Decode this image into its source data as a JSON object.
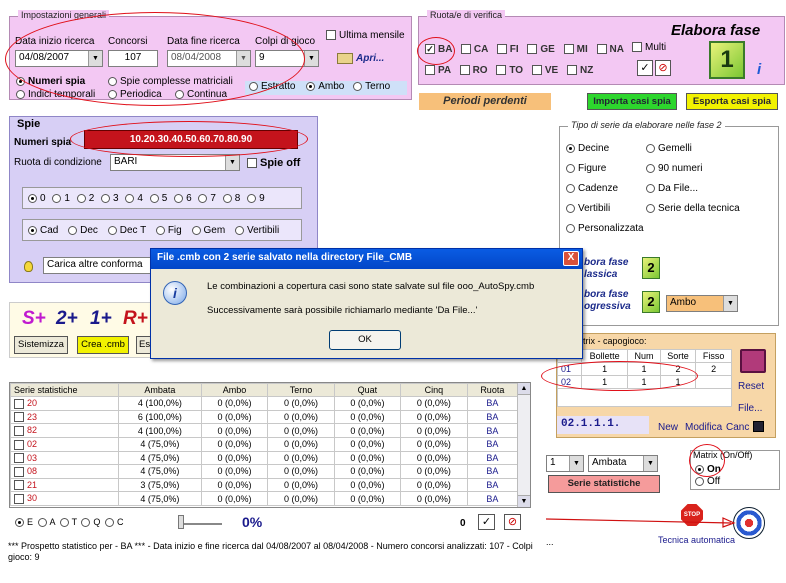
{
  "general": {
    "legend": "Impostazioni generali",
    "date_start_label": "Data inizio ricerca",
    "date_start": "04/08/2007",
    "concorsi_label": "Concorsi",
    "concorsi": "107",
    "date_end_label": "Data fine ricerca",
    "date_end": "08/04/2008",
    "colpi_label": "Colpi di gioco",
    "colpi": "9",
    "ultima_mensile": "Ultima mensile",
    "apri": "Apri...",
    "modes": [
      "Numeri spia",
      "Spie complesse matriciali",
      "Indici temporali",
      "Periodica",
      "Continua"
    ],
    "play_modes": [
      "Estratto",
      "Ambo",
      "Terno"
    ]
  },
  "ruote": {
    "legend": "Ruota/e di verifica",
    "row1": [
      "BA",
      "CA",
      "FI",
      "GE",
      "MI",
      "NA"
    ],
    "row2": [
      "PA",
      "RO",
      "TO",
      "VE",
      "NZ"
    ],
    "multi": "Multi"
  },
  "elabora": {
    "title": "Elabora fase",
    "number": "1"
  },
  "periodi_perdenti": "Periodi perdenti",
  "importa": "Importa casi spia",
  "esporta": "Esporta casi spia",
  "spie": {
    "legend": "Spie",
    "numeri_label": "Numeri spia",
    "numeri_value": "10.20.30.40.50.60.70.80.90",
    "ruota_label": "Ruota di condizione",
    "ruota_value": "BARI",
    "spie_off": "Spie off",
    "digits": [
      "0",
      "1",
      "2",
      "3",
      "4",
      "5",
      "6",
      "7",
      "8",
      "9"
    ],
    "groups": [
      "Cad",
      "Dec",
      "Dec T",
      "Fig",
      "Gem",
      "Vertibili"
    ],
    "carica": "Carica altre conforma"
  },
  "tipo_serie": {
    "legend": "Tipo di serie da elaborare nelle fase 2",
    "left": [
      "Decine",
      "Figure",
      "Cadenze",
      "Vertibili",
      "Personalizzata"
    ],
    "right": [
      "Gemelli",
      "90 numeri",
      "Da File...",
      "Serie della tecnica"
    ],
    "fase_classica": "bora fase\nlassica",
    "fase_progressiva": "bora fase\nogressiva",
    "ambo": "Ambo",
    "fase_num": "2"
  },
  "toolbar_left": {
    "s_plus": "S+",
    "two_plus": "2+",
    "one_plus": "1+",
    "r_plus": "R+",
    "sistemizza": "Sistemizza",
    "crea_cmb": "Crea .cmb",
    "es": "Es"
  },
  "matrix": {
    "legend": "ri Matrix - capogioco:",
    "headers": [
      "",
      "Bollette",
      "Num",
      "Sorte",
      "Fisso"
    ],
    "rows": [
      [
        "01",
        "1",
        "1",
        "2",
        "2"
      ],
      [
        "02",
        "1",
        "1",
        "1",
        ""
      ]
    ],
    "code": "02.1.1.1.",
    "new": "New",
    "modifica": "Modifica",
    "canc": "Canc",
    "reset": "Reset",
    "file": "File..."
  },
  "stats": {
    "headers": [
      "Serie statistiche",
      "Ambata",
      "Ambo",
      "Terno",
      "Quat",
      "Cinq",
      "Ruota"
    ],
    "rows": [
      [
        "20",
        "4 (100,0%)",
        "0 (0,0%)",
        "0 (0,0%)",
        "0 (0,0%)",
        "0 (0,0%)",
        "BA"
      ],
      [
        "23",
        "6 (100,0%)",
        "0 (0,0%)",
        "0 (0,0%)",
        "0 (0,0%)",
        "0 (0,0%)",
        "BA"
      ],
      [
        "82",
        "4 (100,0%)",
        "0 (0,0%)",
        "0 (0,0%)",
        "0 (0,0%)",
        "0 (0,0%)",
        "BA"
      ],
      [
        "02",
        "4 (75,0%)",
        "0 (0,0%)",
        "0 (0,0%)",
        "0 (0,0%)",
        "0 (0,0%)",
        "BA"
      ],
      [
        "03",
        "4 (75,0%)",
        "0 (0,0%)",
        "0 (0,0%)",
        "0 (0,0%)",
        "0 (0,0%)",
        "BA"
      ],
      [
        "08",
        "4 (75,0%)",
        "0 (0,0%)",
        "0 (0,0%)",
        "0 (0,0%)",
        "0 (0,0%)",
        "BA"
      ],
      [
        "21",
        "3 (75,0%)",
        "0 (0,0%)",
        "0 (0,0%)",
        "0 (0,0%)",
        "0 (0,0%)",
        "BA"
      ],
      [
        "30",
        "4 (75,0%)",
        "0 (0,0%)",
        "0 (0,0%)",
        "0 (0,0%)",
        "0 (0,0%)",
        "BA"
      ]
    ],
    "filters": [
      "E",
      "A",
      "T",
      "Q",
      "C"
    ],
    "percent": "0%",
    "zero": "0"
  },
  "right_bottom": {
    "num": "1",
    "sorte": "Ambata",
    "serie_statistiche": "Serie statistiche",
    "matrix_legend": "Matrix (On/Off)",
    "on": "On",
    "off": "Off",
    "stop": "STOP",
    "tecnica": "Tecnica automatica",
    "dots": "..."
  },
  "status": "*** Prospetto statistico per  - BA ***  - Data inizio e fine ricerca dal 04/08/2007 al 08/04/2008 - Numero concorsi analizzati: 107 - Colpi gioco: 9",
  "dialog": {
    "title": "File .cmb con 2 serie salvato nella directory File_CMB",
    "line1": "Le combinazioni a copertura casi sono state salvate sul file ooo_AutoSpy.cmb",
    "line2": "Successivamente sarà possibile richiamarlo mediante 'Da File...'",
    "ok": "OK",
    "close": "X"
  },
  "colors": {
    "pink": "#f3c8f3",
    "lilac": "#d7cff5",
    "red_field": "#c4131c",
    "green_btn": "#2dd62d",
    "yellow_btn": "#f2f200",
    "orange": "#f7c07a"
  }
}
